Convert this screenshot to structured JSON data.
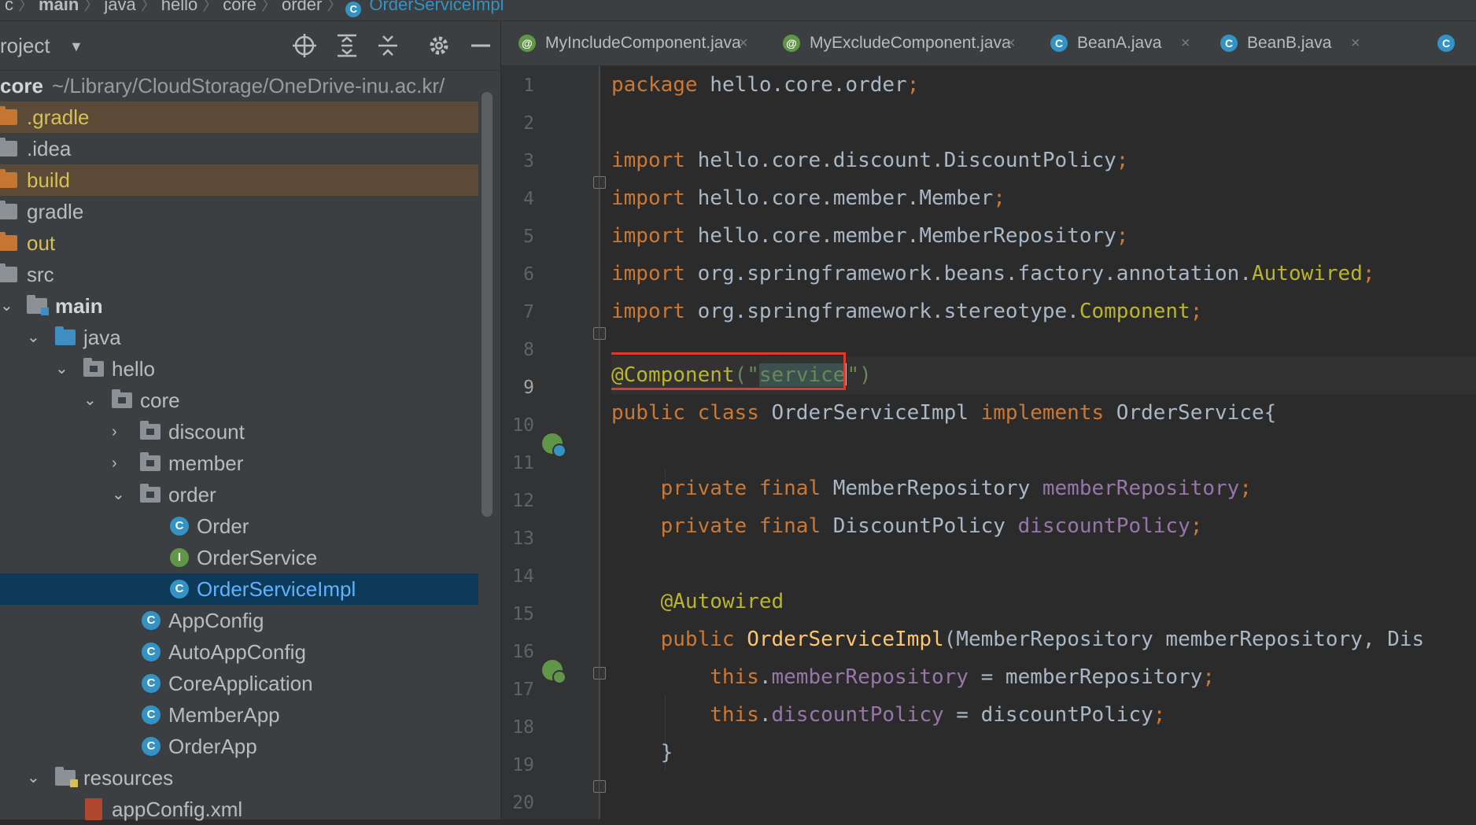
{
  "breadcrumb": [
    "c",
    "main",
    "java",
    "hello",
    "core",
    "order",
    "OrderServiceImpl"
  ],
  "project_panel": {
    "title": "roject",
    "root": {
      "name": "core",
      "path": "~/Library/CloudStorage/OneDrive-inu.ac.kr/"
    },
    "items": [
      {
        "label": ".gradle"
      },
      {
        "label": ".idea"
      },
      {
        "label": "build"
      },
      {
        "label": "gradle"
      },
      {
        "label": "out"
      },
      {
        "label": "src"
      },
      {
        "label": "main"
      },
      {
        "label": "java"
      },
      {
        "label": "hello"
      },
      {
        "label": "core"
      },
      {
        "label": "discount"
      },
      {
        "label": "member"
      },
      {
        "label": "order"
      },
      {
        "label": "Order"
      },
      {
        "label": "OrderService"
      },
      {
        "label": "OrderServiceImpl"
      },
      {
        "label": "AppConfig"
      },
      {
        "label": "AutoAppConfig"
      },
      {
        "label": "CoreApplication"
      },
      {
        "label": "MemberApp"
      },
      {
        "label": "OrderApp"
      },
      {
        "label": "resources"
      },
      {
        "label": "appConfig.xml"
      }
    ]
  },
  "tabs": [
    {
      "label": "MyIncludeComponent.java",
      "icon": "@"
    },
    {
      "label": "MyExcludeComponent.java",
      "icon": "@"
    },
    {
      "label": "BeanA.java",
      "icon": "C"
    },
    {
      "label": "BeanB.java",
      "icon": "C"
    }
  ],
  "tab_close": "×",
  "line_numbers": [
    "1",
    "2",
    "3",
    "4",
    "5",
    "6",
    "7",
    "8",
    "9",
    "10",
    "11",
    "12",
    "13",
    "14",
    "15",
    "16",
    "17",
    "18",
    "19",
    "20"
  ],
  "code": {
    "l1": {
      "kw": "package",
      "rest": " hello.core.order",
      "semi": ";"
    },
    "l3": {
      "kw": "import",
      "rest": " hello.core.discount.DiscountPolicy",
      "semi": ";"
    },
    "l4": {
      "kw": "import",
      "rest": " hello.core.member.Member",
      "semi": ";"
    },
    "l5": {
      "kw": "import",
      "rest": " hello.core.member.MemberRepository",
      "semi": ";"
    },
    "l6": {
      "kw": "import",
      "rest": " org.springframework.beans.factory.annotation.",
      "ann": "Autowired",
      "semi": ";"
    },
    "l7": {
      "kw": "import",
      "rest": " org.springframework.stereotype.",
      "ann": "Component",
      "semi": ";"
    },
    "l9": {
      "ann": "@Component",
      "open": "(\"",
      "str": "service",
      "close": "\")"
    },
    "l10": {
      "kw1": "public",
      "kw2": " class",
      "name": " OrderServiceImpl",
      "kw3": " implements",
      "iface": " OrderService{"
    },
    "l12": {
      "kw": "    private final",
      "type": " MemberRepository",
      "field": " memberRepository",
      "semi": ";"
    },
    "l13": {
      "kw": "    private final",
      "type": " DiscountPolicy",
      "field": " discountPolicy",
      "semi": ";"
    },
    "l15": {
      "ann": "    @Autowired"
    },
    "l16": {
      "kw": "    public",
      "meth": " OrderServiceImpl",
      "params": "(MemberRepository memberRepository, ",
      "cut": "Dis"
    },
    "l17": {
      "kw": "        this",
      "dot": ".",
      "field": "memberRepository",
      "rest": " = memberRepository",
      "semi": ";"
    },
    "l18": {
      "kw": "        this",
      "dot": ".",
      "field": "discountPolicy",
      "rest": " = discountPolicy",
      "semi": ";"
    },
    "l19": {
      "text": "    }"
    }
  }
}
